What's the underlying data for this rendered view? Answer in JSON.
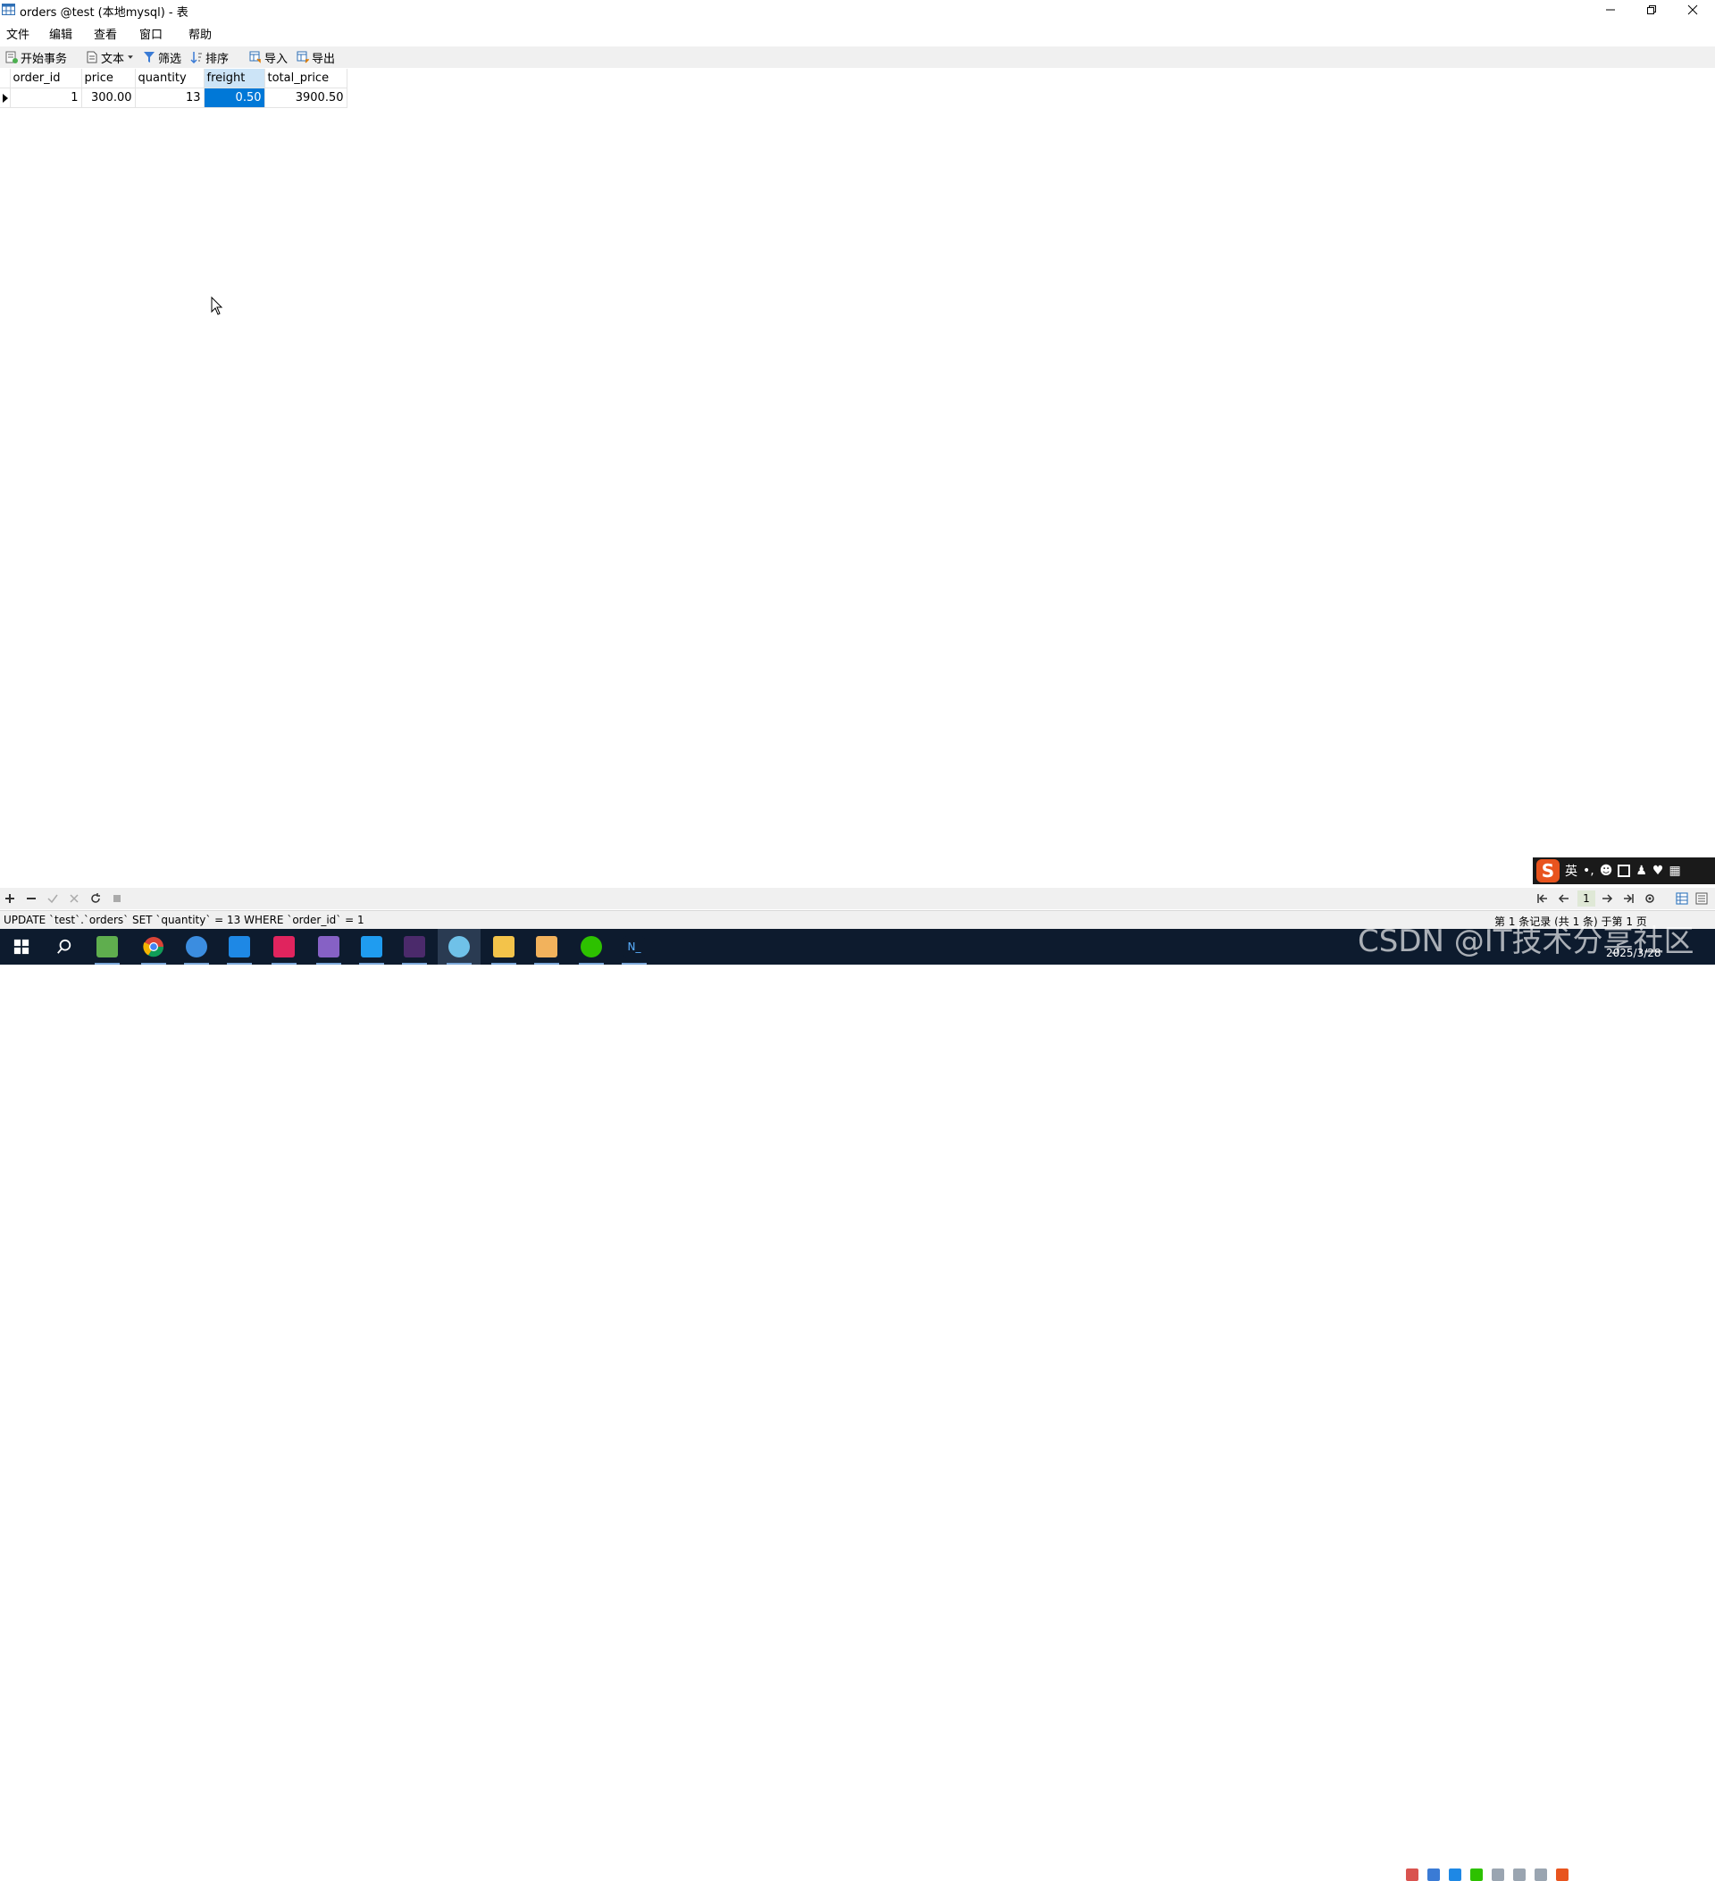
{
  "window": {
    "title": "orders @test (本地mysql) - 表"
  },
  "menu": {
    "items": [
      "文件",
      "编辑",
      "查看",
      "窗口",
      "帮助"
    ]
  },
  "toolbar": {
    "begin_transaction": "开始事务",
    "text": "文本",
    "filter": "筛选",
    "sort": "排序",
    "import": "导入",
    "export": "导出"
  },
  "grid": {
    "columns": [
      "order_id",
      "price",
      "quantity",
      "freight",
      "total_price"
    ],
    "rows": [
      [
        "1",
        "300.00",
        "13",
        "0.50",
        "3900.50"
      ]
    ],
    "selected_column": "freight"
  },
  "navigation": {
    "current_page": "1"
  },
  "status": {
    "sql": "UPDATE `test`.`orders` SET `quantity` = 13 WHERE `order_id` = 1",
    "records": "第 1 条记录 (共 1 条) 于第 1 页"
  },
  "ime": {
    "logo": "S",
    "lang": "英"
  },
  "taskbar": {
    "date": "2025/3/28",
    "watermark": "CSDN @IT技术分享社区",
    "accent": "#0078d7"
  }
}
